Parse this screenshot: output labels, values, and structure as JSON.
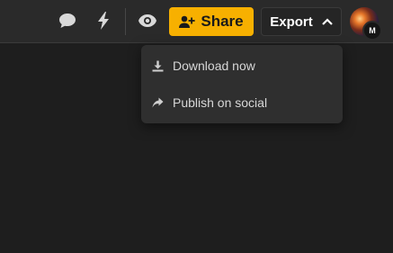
{
  "toolbar": {
    "comment_icon": "comment-icon",
    "flash_icon": "flash-icon",
    "preview_icon": "eye-icon",
    "share_label": "Share",
    "export_label": "Export",
    "avatar_initial": "M"
  },
  "export_menu": {
    "items": [
      {
        "label": "Download now",
        "icon": "download-icon"
      },
      {
        "label": "Publish on social",
        "icon": "share-arrow-icon"
      }
    ]
  },
  "colors": {
    "accent": "#f7b000",
    "background": "#1e1e1e",
    "toolbar": "#2a2a2a",
    "menu": "#2f2f2f"
  }
}
